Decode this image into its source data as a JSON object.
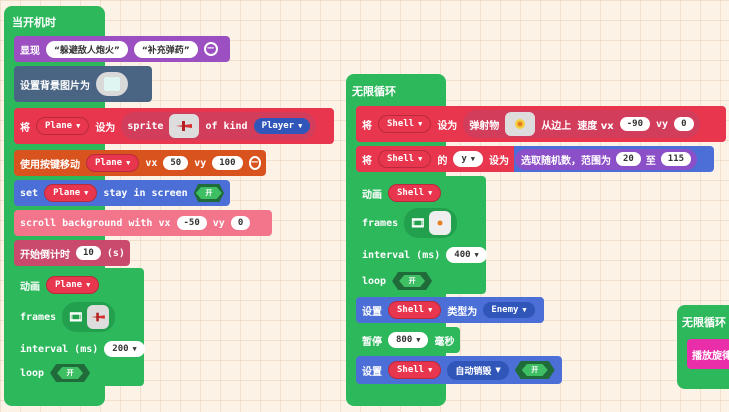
{
  "events": {
    "on_start": "当开机时",
    "forever": "无限循环"
  },
  "left": {
    "splash": {
      "label": "显现",
      "text1": "“躲避敌人炮火”",
      "text2": "“补充弹药”"
    },
    "set_bg": {
      "label": "设置背景图片为"
    },
    "set_sprite": {
      "prefix": "将",
      "var": "Plane",
      "set_to": "设为",
      "sprite_word": "sprite",
      "of_kind": "of kind",
      "kind": "Player"
    },
    "move_buttons": {
      "label": "使用按键移动",
      "var": "Plane",
      "vx_label": "vx",
      "vx": "50",
      "vy_label": "vy",
      "vy": "100"
    },
    "stay_screen": {
      "set": "set",
      "var": "Plane",
      "label": "stay in screen",
      "toggle": "开"
    },
    "scroll_bg": {
      "label": "scroll background with vx",
      "vx": "-50",
      "vy_label": "vy",
      "vy": "0"
    },
    "countdown": {
      "label": "开始倒计时",
      "value": "10",
      "unit": "(s)"
    },
    "animate": {
      "label": "动画",
      "var": "Plane",
      "frames": "frames",
      "interval": "interval (ms)",
      "interval_value": "200",
      "loop": "loop",
      "toggle": "开"
    }
  },
  "middle": {
    "set_shell": {
      "prefix": "将",
      "var": "Shell",
      "set_to": "设为",
      "projectile": "弹射物",
      "from_side": "从边上",
      "speed_vx": "速度 vx",
      "vx": "-90",
      "vy_label": "vy",
      "vy": "0"
    },
    "set_y": {
      "prefix": "将",
      "var": "Shell",
      "of": "的",
      "prop": "y",
      "set_to": "设为",
      "random": "选取随机数，范围为",
      "from": "20",
      "to_label": "至",
      "to": "115"
    },
    "animate": {
      "label": "动画",
      "var": "Shell",
      "frames": "frames",
      "interval": "interval (ms)",
      "interval_value": "400",
      "loop": "loop",
      "toggle": "开"
    },
    "set_kind": {
      "label": "设置",
      "var": "Shell",
      "kind_label": "类型为",
      "kind": "Enemy"
    },
    "pause": {
      "label": "暂停",
      "value": "800",
      "unit": "毫秒"
    },
    "auto_destroy": {
      "label": "设置",
      "var": "Shell",
      "option": "自动销毁",
      "toggle": "开"
    }
  },
  "right": {
    "play_partial": "播放旋律"
  },
  "colors": {
    "event": "#2db85c",
    "looks": "#9b4fc0",
    "scene": "#4a6483",
    "sprites": "#e8364e",
    "controller": "#d9531f",
    "info": "#c94a6c",
    "loops": "#2db85c",
    "music": "#ea2ea9"
  }
}
